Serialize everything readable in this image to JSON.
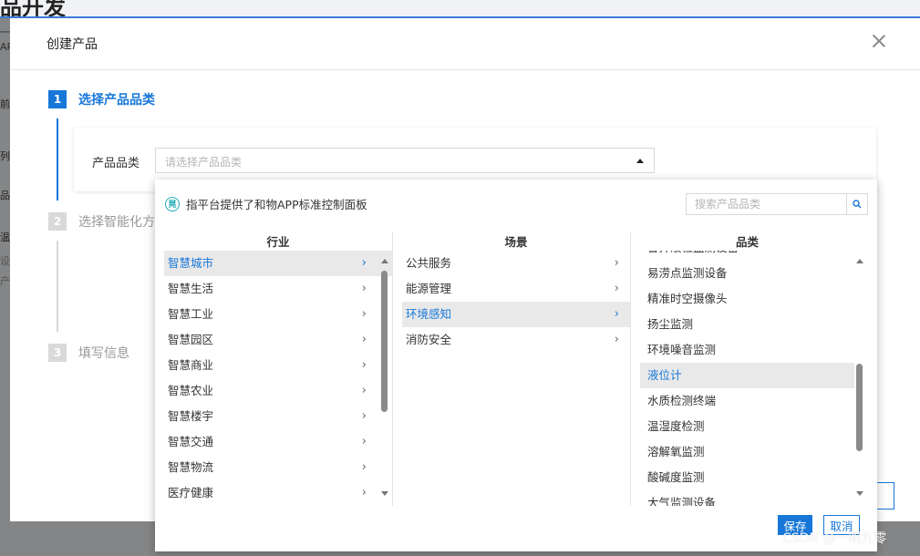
{
  "background_page": {
    "title_fragment": "品开发",
    "fragments": [
      "一",
      "AP",
      "前的",
      "列表",
      "品名",
      "温",
      "设",
      "产"
    ]
  },
  "modal": {
    "title": "创建产品"
  },
  "steps": [
    {
      "number": "1",
      "label": "选择产品品类",
      "active": true
    },
    {
      "number": "2",
      "label": "选择智能化方",
      "active": false
    },
    {
      "number": "3",
      "label": "填写信息",
      "active": false
    }
  ],
  "form": {
    "category_label": "产品品类",
    "category_placeholder": "请选择产品品类"
  },
  "dropdown": {
    "notice_icon_text": "晃",
    "notice_text": "指平台提供了和物APP标准控制面板",
    "search_placeholder": "搜索产品品类",
    "columns": {
      "industry": {
        "header": "行业",
        "items": [
          "智慧城市",
          "智慧生活",
          "智慧工业",
          "智慧园区",
          "智慧商业",
          "智慧农业",
          "智慧楼宇",
          "智慧交通",
          "智慧物流",
          "医疗健康"
        ],
        "selected_index": 0
      },
      "scene": {
        "header": "场景",
        "items": [
          "公共服务",
          "能源管理",
          "环境感知",
          "消防安全"
        ],
        "selected_index": 2
      },
      "category": {
        "header": "品类",
        "items": [
          "窨井液位监测设备",
          "易涝点监测设备",
          "精准时空摄像头",
          "扬尘监测",
          "环境噪音监测",
          "液位计",
          "水质检测终端",
          "温湿度检测",
          "溶解氧监测",
          "酸碱度监测",
          "大气监测设备"
        ],
        "selected_index": 5
      }
    },
    "save_label": "保存",
    "cancel_label": "取消"
  },
  "colors": {
    "accent": "#1677d8",
    "step_inactive": "#d9d9d9",
    "selected_row_bg": "#e9e9e9",
    "notice_icon": "#20a9b5"
  },
  "watermark": "CSDN @一明九零"
}
